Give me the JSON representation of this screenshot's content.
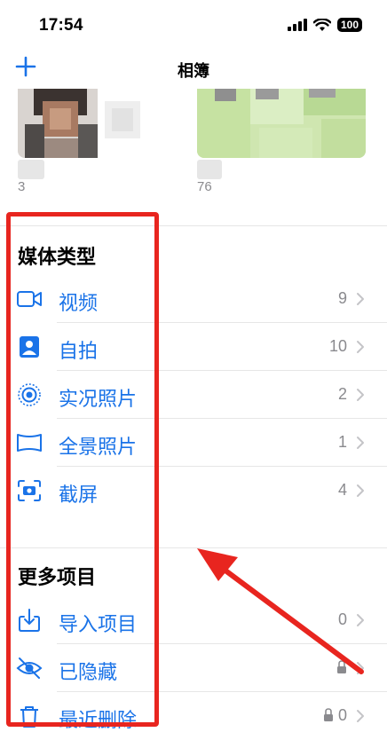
{
  "status": {
    "time": "17:54",
    "battery": "100"
  },
  "nav": {
    "title": "相簿"
  },
  "albums": [
    {
      "count": "3"
    },
    {
      "count": "76"
    }
  ],
  "media_types": {
    "title": "媒体类型",
    "items": [
      {
        "label": "视频",
        "count": "9",
        "icon": "video-icon"
      },
      {
        "label": "自拍",
        "count": "10",
        "icon": "selfie-icon"
      },
      {
        "label": "实况照片",
        "count": "2",
        "icon": "live-photo-icon"
      },
      {
        "label": "全景照片",
        "count": "1",
        "icon": "panorama-icon"
      },
      {
        "label": "截屏",
        "count": "4",
        "icon": "screenshot-icon"
      }
    ]
  },
  "more_items": {
    "title": "更多项目",
    "items": [
      {
        "label": "导入项目",
        "count": "0",
        "icon": "import-icon"
      },
      {
        "label": "已隐藏",
        "icon": "hidden-icon",
        "locked": true
      },
      {
        "label": "最近删除",
        "count": "0",
        "icon": "trash-icon",
        "locked": true
      }
    ]
  },
  "colors": {
    "accent": "#1a73e8",
    "annotation": "#e8251f"
  }
}
